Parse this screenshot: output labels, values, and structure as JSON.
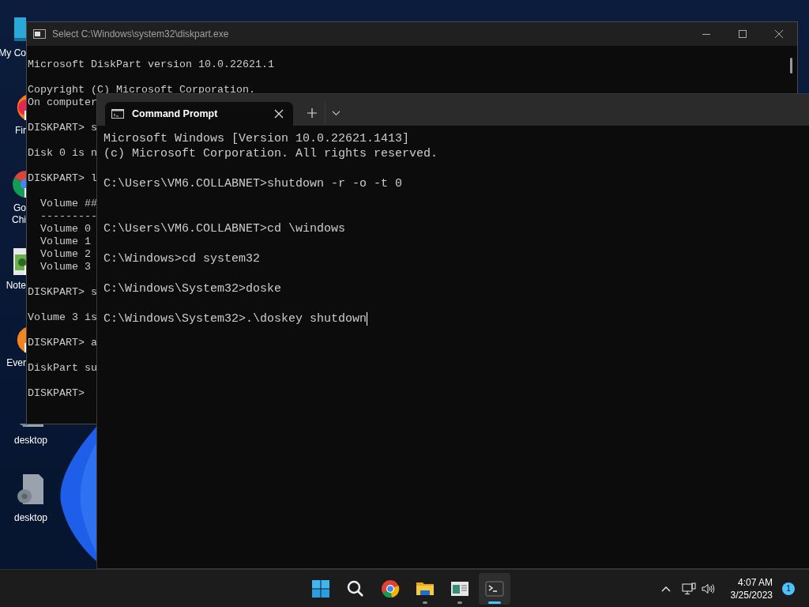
{
  "desktop_icons": [
    {
      "kind": "monitor",
      "shortcut": false,
      "label_lines": [
        "My Co"
      ]
    },
    {
      "kind": "firefox",
      "shortcut": true,
      "label_lines": [
        "Fir"
      ]
    },
    {
      "kind": "chrome",
      "shortcut": true,
      "label_lines": [
        "Go",
        "Chi"
      ]
    },
    {
      "kind": "notepad",
      "shortcut": true,
      "label_lines": [
        "Note"
      ]
    },
    {
      "kind": "evernote",
      "shortcut": true,
      "label_lines": [
        "Ever"
      ]
    },
    {
      "kind": "file_partial",
      "shortcut": false,
      "label_lines": [
        "desktop"
      ]
    },
    {
      "kind": "file",
      "shortcut": false,
      "label_lines": [
        "desktop"
      ]
    }
  ],
  "diskpart_window": {
    "title": "Select C:\\Windows\\system32\\diskpart.exe",
    "blocks": [
      [
        "Microsoft DiskPart version 10.0.22621.1"
      ],
      [
        "Copyright (C) Microsoft Corporation.",
        "On computer"
      ],
      [
        "DISKPART> s"
      ],
      [
        "Disk 0 is n"
      ],
      [
        "DISKPART> l"
      ],
      [
        "  Volume ##",
        "  ---------",
        "  Volume 0",
        "  Volume 1",
        "  Volume 2",
        "  Volume 3"
      ],
      [
        "DISKPART> s"
      ],
      [
        "Volume 3 is"
      ],
      [
        "DISKPART> a"
      ],
      [
        "DiskPart su"
      ],
      [
        "DISKPART>"
      ]
    ]
  },
  "cmd_window": {
    "tabs": [
      {
        "label": "Command Prompt",
        "selected": true
      }
    ],
    "cursor_visible": true,
    "blocks": [
      {
        "lines": [
          "Microsoft Windows [Version 10.0.22621.1413]",
          "(c) Microsoft Corporation. All rights reserved."
        ]
      },
      {
        "lines": [
          "C:\\Users\\VM6.COLLABNET>shutdown -r -o -t 0"
        ],
        "extra_gap": true
      },
      {
        "lines": [
          "C:\\Users\\VM6.COLLABNET>cd \\windows"
        ]
      },
      {
        "lines": [
          "C:\\Windows>cd system32"
        ]
      },
      {
        "lines": [
          "C:\\Windows\\System32>doske"
        ]
      },
      {
        "lines": [
          "C:\\Windows\\System32>.\\doskey shutdown"
        ]
      }
    ]
  },
  "taskbar": {
    "apps": [
      {
        "kind": "start",
        "running": false,
        "selected": false
      },
      {
        "kind": "search",
        "running": false,
        "selected": false
      },
      {
        "kind": "chrome",
        "running": false,
        "selected": false
      },
      {
        "kind": "explorer",
        "running": true,
        "selected": false
      },
      {
        "kind": "app",
        "running": true,
        "selected": false
      },
      {
        "kind": "terminal",
        "running": true,
        "selected": true
      }
    ],
    "tray": {
      "time": "4:07 AM",
      "date": "3/25/2023",
      "notifications": "1"
    }
  }
}
